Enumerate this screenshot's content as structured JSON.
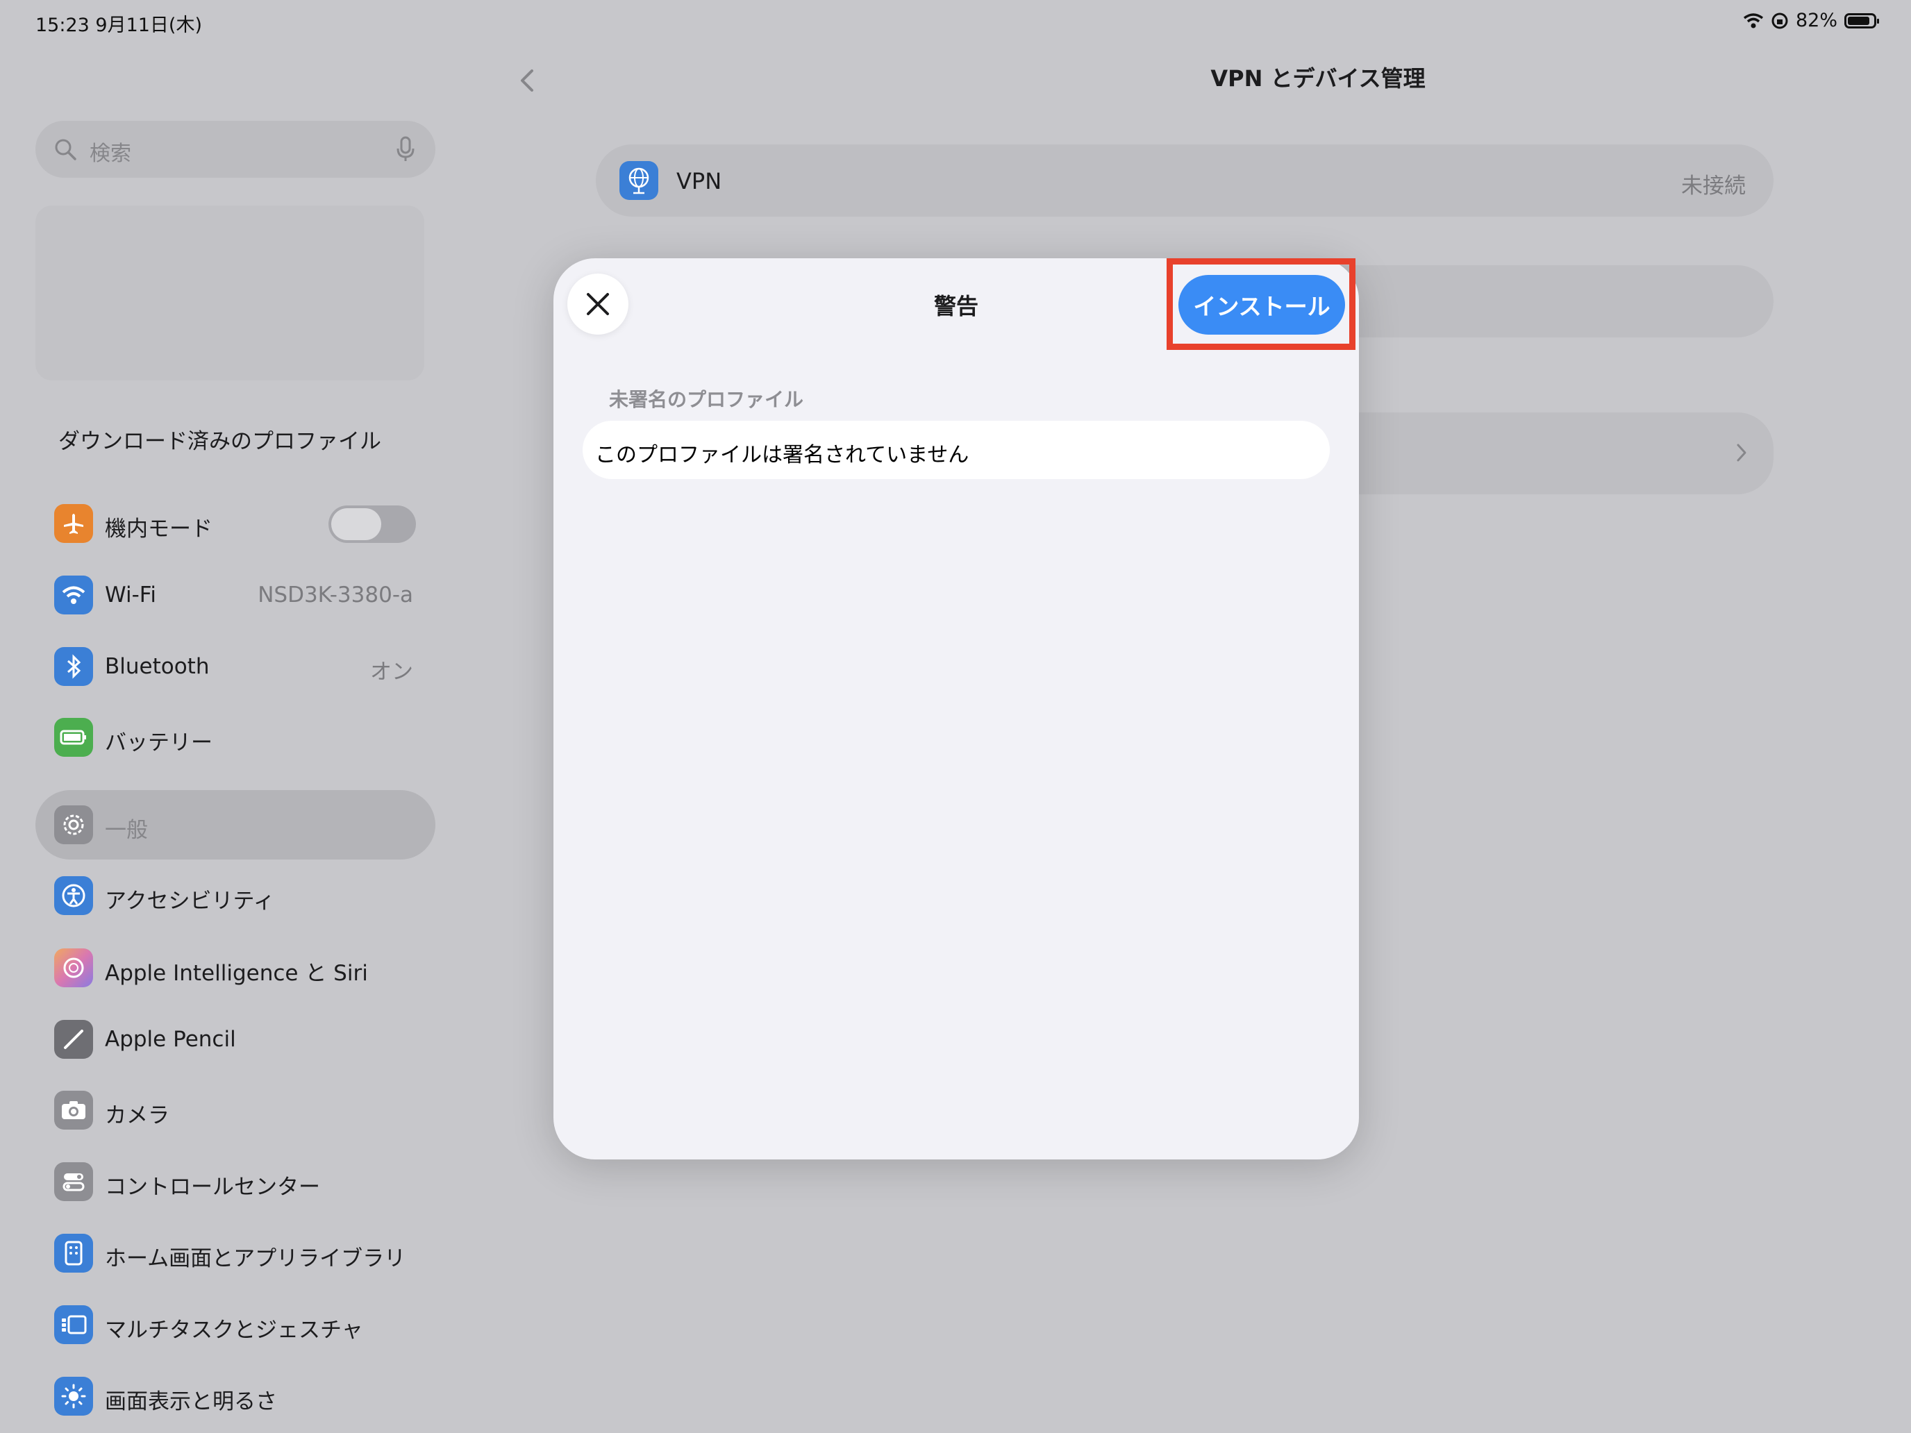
{
  "status_bar": {
    "time": "15:23  9月11日(木)",
    "battery_percent": "82%"
  },
  "sidebar": {
    "search_placeholder": "検索",
    "downloaded_profile": "ダウンロード済みのプロファイル",
    "items": [
      {
        "label": "機内モード",
        "value": "",
        "icon": "airplane-icon",
        "color": "#e8842e"
      },
      {
        "label": "Wi-Fi",
        "value": "NSD3K-3380-a",
        "icon": "wifi-icon",
        "color": "#3b7fd6"
      },
      {
        "label": "Bluetooth",
        "value": "オン",
        "icon": "bluetooth-icon",
        "color": "#3b7fd6"
      },
      {
        "label": "バッテリー",
        "value": "",
        "icon": "battery-icon",
        "color": "#4cae4f"
      },
      {
        "label": "一般",
        "value": "",
        "icon": "gear-icon",
        "color": "#8e8e93"
      },
      {
        "label": "アクセシビリティ",
        "value": "",
        "icon": "accessibility-icon",
        "color": "#3b7fd6"
      },
      {
        "label": "Apple Intelligence と Siri",
        "value": "",
        "icon": "siri-icon",
        "color": "#d98aa8"
      },
      {
        "label": "Apple Pencil",
        "value": "",
        "icon": "pencil-icon",
        "color": "#6e6e73"
      },
      {
        "label": "カメラ",
        "value": "",
        "icon": "camera-icon",
        "color": "#8e8e93"
      },
      {
        "label": "コントロールセンター",
        "value": "",
        "icon": "control-center-icon",
        "color": "#8e8e93"
      },
      {
        "label": "ホーム画面とアプリライブラリ",
        "value": "",
        "icon": "home-screen-icon",
        "color": "#3b7fd6"
      },
      {
        "label": "マルチタスクとジェスチャ",
        "value": "",
        "icon": "multitask-icon",
        "color": "#3b7fd6"
      },
      {
        "label": "画面表示と明るさ",
        "value": "",
        "icon": "brightness-icon",
        "color": "#3b7fd6"
      }
    ],
    "airplane_mode_on": false
  },
  "detail": {
    "nav_title": "VPN とデバイス管理",
    "vpn_label": "VPN",
    "vpn_status": "未接続"
  },
  "modal": {
    "title": "警告",
    "install_label": "インストール",
    "section_header": "未署名のプロファイル",
    "message": "このプロファイルは署名されていません",
    "accent_color": "#3a8cf5",
    "highlight_color": "#e8412c"
  }
}
